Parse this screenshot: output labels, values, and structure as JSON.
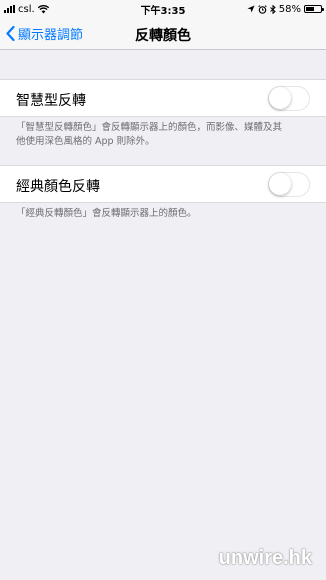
{
  "status": {
    "carrier": "csl.",
    "time": "下午3:35",
    "battery_text": "58%",
    "battery_level": 0.58
  },
  "nav": {
    "back_label": "顯示器調節",
    "title": "反轉顏色"
  },
  "settings": {
    "smart_invert": {
      "label": "智慧型反轉",
      "enabled": false,
      "footer_line1": "「智慧型反轉顏色」會反轉顯示器上的顏色，而影像、媒體及其",
      "footer_line2": "他使用深色風格的 App 則除外。"
    },
    "classic_invert": {
      "label": "經典顏色反轉",
      "enabled": false,
      "footer": "「經典反轉顏色」會反轉顯示器上的顏色。"
    }
  },
  "watermark": "unwire.hk",
  "colors": {
    "accent": "#007aff",
    "background": "#efeff4",
    "toggle_off_border": "#e5e5ea",
    "footer_text": "#6d6d72"
  }
}
